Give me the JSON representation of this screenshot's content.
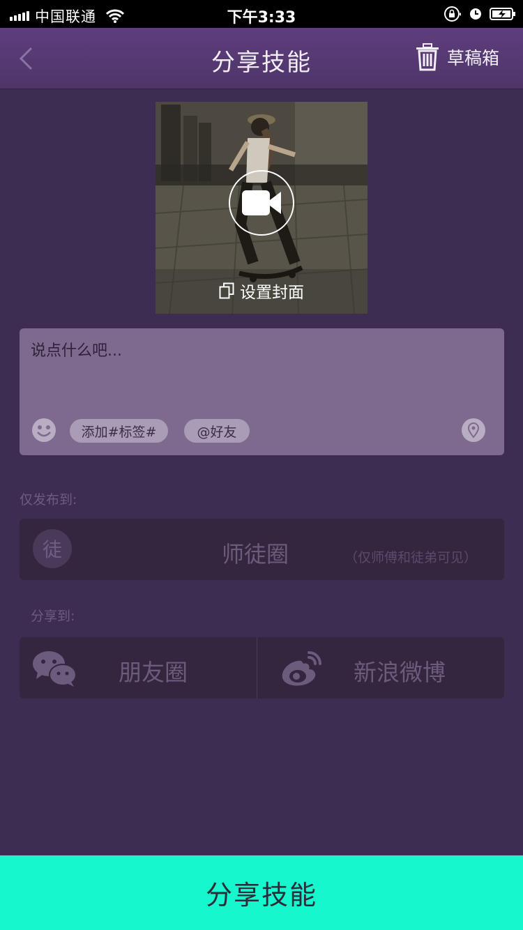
{
  "status_bar": {
    "carrier": "中国联通",
    "time": "下午3:33"
  },
  "nav": {
    "title": "分享技能",
    "drafts_label": "草稿箱"
  },
  "cover": {
    "set_cover_label": "设置封面"
  },
  "composer": {
    "placeholder": "说点什么吧...",
    "tag_chip": "添加#标签#",
    "friend_chip": "@好友"
  },
  "publish": {
    "section_label": "仅发布到:",
    "badge": "徒",
    "title": "师徒圈",
    "note": "（仅师傅和徒弟可见）"
  },
  "share": {
    "section_label": "分享到:",
    "items": [
      {
        "label": "朋友圈",
        "icon": "wechat-moments-icon"
      },
      {
        "label": "新浪微博",
        "icon": "weibo-icon"
      }
    ]
  },
  "submit": {
    "label": "分享技能"
  },
  "colors": {
    "accent": "#17f7cd",
    "nav": "#5f3d7d",
    "background": "#3e2d52"
  }
}
